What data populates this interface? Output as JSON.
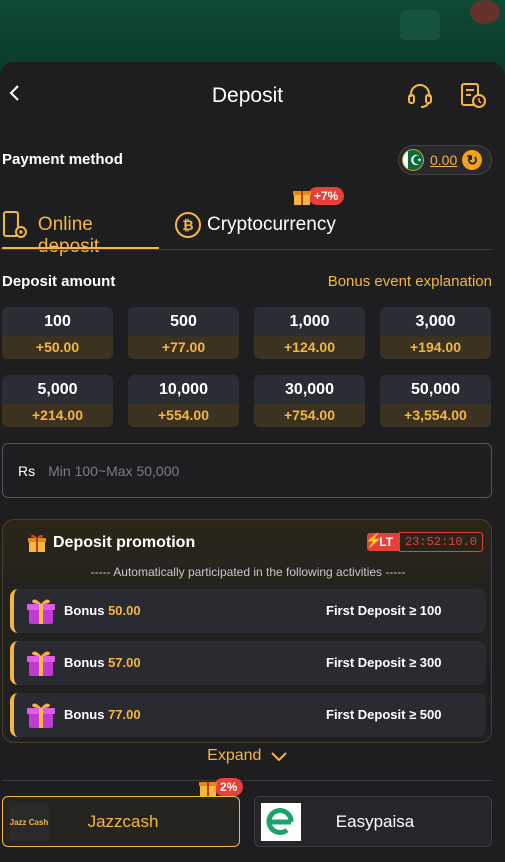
{
  "header": {
    "title": "Deposit",
    "back": "back-arrow-icon",
    "support": "headset-icon",
    "history": "record-clock-icon"
  },
  "payment": {
    "label": "Payment method",
    "balance": "0.00",
    "flag_glyph": "☪",
    "refresh_glyph": "↻"
  },
  "tabs": [
    {
      "label": "Online deposit",
      "icon": "phone-deposit-icon",
      "active": true
    },
    {
      "label": "Cryptocurrency",
      "icon": "bitcoin-icon",
      "btc_glyph": "₿",
      "badge": "+7%"
    }
  ],
  "amount": {
    "label": "Deposit amount",
    "bonus_link": "Bonus event explanation"
  },
  "amounts": [
    {
      "value": "100",
      "bonus": "+50.00"
    },
    {
      "value": "500",
      "bonus": "+77.00"
    },
    {
      "value": "1,000",
      "bonus": "+124.00"
    },
    {
      "value": "3,000",
      "bonus": "+194.00"
    },
    {
      "value": "5,000",
      "bonus": "+214.00"
    },
    {
      "value": "10,000",
      "bonus": "+554.00"
    },
    {
      "value": "30,000",
      "bonus": "+754.00"
    },
    {
      "value": "50,000",
      "bonus": "+3,554.00"
    }
  ],
  "input": {
    "currency": "Rs",
    "placeholder": "Min 100~Max 50,000"
  },
  "promo": {
    "title": "Deposit promotion",
    "lt": "LT",
    "countdown": "23:52:10.0",
    "subtitle": "----- Automatically participated in the following activities -----",
    "rows": [
      {
        "label": "Bonus",
        "value": "50.00",
        "condition": "First Deposit ≥ 100"
      },
      {
        "label": "Bonus",
        "value": "57.00",
        "condition": "First Deposit ≥ 300"
      },
      {
        "label": "Bonus",
        "value": "77.00",
        "condition": "First Deposit ≥ 500"
      }
    ],
    "expand": "Expand"
  },
  "channels": [
    {
      "name": "Jazzcash",
      "logo_text": "Jazz Cash",
      "badge": "2%",
      "selected": true
    },
    {
      "name": "Easypaisa",
      "selected": false
    }
  ],
  "colors": {
    "accent": "#f5b740",
    "panel": "#1e1e21",
    "badge": "#e5403a"
  }
}
